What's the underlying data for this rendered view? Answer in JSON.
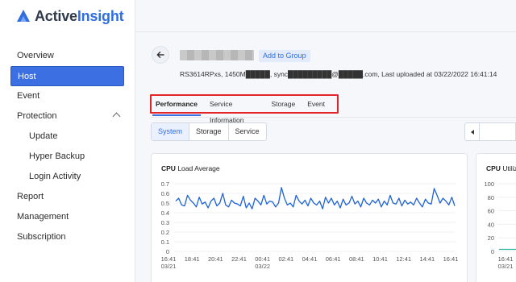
{
  "brand": {
    "name_a": "Active",
    "name_b": "Insight",
    "accent": "#2f6fe0"
  },
  "sidebar": {
    "items": [
      {
        "label": "Overview"
      },
      {
        "label": "Host"
      },
      {
        "label": "Event"
      },
      {
        "label": "Protection"
      },
      {
        "label": "Update"
      },
      {
        "label": "Hyper Backup"
      },
      {
        "label": "Login Activity"
      },
      {
        "label": "Report"
      },
      {
        "label": "Management"
      },
      {
        "label": "Subscription"
      }
    ]
  },
  "device": {
    "add_group_label": "Add to Group",
    "info": "RS3614RPxs, 1450M█████, sync█████████@█████.com, Last uploaded at 03/22/2022 16:41:14"
  },
  "tabs": [
    {
      "label": "Performance"
    },
    {
      "label": "Service Information"
    },
    {
      "label": "Storage"
    },
    {
      "label": "Event"
    }
  ],
  "segments": [
    {
      "label": "System"
    },
    {
      "label": "Storage"
    },
    {
      "label": "Service"
    }
  ],
  "cards": {
    "cpu_load": {
      "title_bold": "CPU",
      "title_rest": " Load Average"
    },
    "cpu_util": {
      "title_bold": "CPU",
      "title_rest": " Utiliz"
    }
  },
  "chart_data": [
    {
      "type": "line",
      "title": "CPU Load Average",
      "color": "#1f63d6",
      "yticks": [
        "0.7",
        "0.6",
        "0.5",
        "0.4",
        "0.3",
        "0.2",
        "0.1",
        "0"
      ],
      "ylim": [
        0,
        0.7
      ],
      "xticks": [
        "16:41\n03/21",
        "18:41",
        "20:41",
        "22:41",
        "00:41\n03/22",
        "02:41",
        "04:41",
        "06:41",
        "08:41",
        "10:41",
        "12:41",
        "14:41",
        "16:41"
      ],
      "series": [
        {
          "values": [
            0.52,
            0.55,
            0.48,
            0.47,
            0.58,
            0.53,
            0.5,
            0.46,
            0.56,
            0.49,
            0.51,
            0.45,
            0.52,
            0.55,
            0.47,
            0.5,
            0.6,
            0.48,
            0.46,
            0.53,
            0.5,
            0.49,
            0.47,
            0.57,
            0.45,
            0.5,
            0.44,
            0.55,
            0.52,
            0.48,
            0.58,
            0.49,
            0.52,
            0.51,
            0.46,
            0.5,
            0.66,
            0.55,
            0.48,
            0.5,
            0.46,
            0.58,
            0.52,
            0.49,
            0.53,
            0.47,
            0.55,
            0.5,
            0.48,
            0.52,
            0.44,
            0.56,
            0.5,
            0.55,
            0.48,
            0.52,
            0.45,
            0.54,
            0.48,
            0.5,
            0.57,
            0.49,
            0.52,
            0.46,
            0.55,
            0.5,
            0.48,
            0.53,
            0.5,
            0.54,
            0.46,
            0.52,
            0.48,
            0.58,
            0.5,
            0.49,
            0.55,
            0.47,
            0.53,
            0.49,
            0.51,
            0.48,
            0.55,
            0.5,
            0.46,
            0.54,
            0.5,
            0.49,
            0.65,
            0.58,
            0.5,
            0.55,
            0.52,
            0.48,
            0.56,
            0.47
          ]
        }
      ]
    },
    {
      "type": "line",
      "title": "CPU Utilization",
      "color": "#2bb5a0",
      "yticks": [
        "100",
        "80",
        "60",
        "40",
        "20",
        "0"
      ],
      "ylim": [
        0,
        100
      ],
      "xticks": [
        "16:41\n03/21"
      ],
      "series": [
        {
          "values": [
            3,
            3,
            3,
            3,
            3
          ]
        }
      ]
    }
  ]
}
